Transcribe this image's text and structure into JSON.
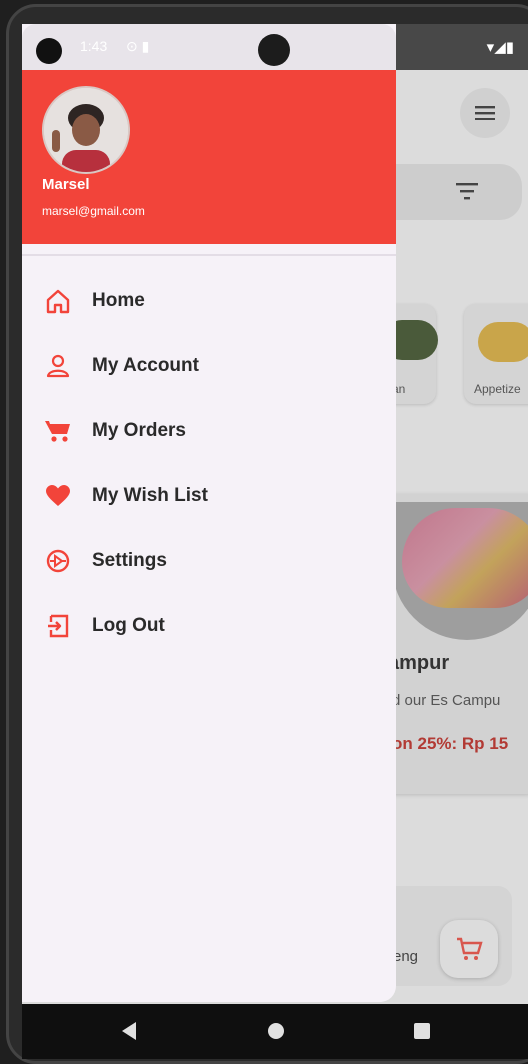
{
  "status_bar": {
    "time": "1:43",
    "notification_icons": "⊙ ▮",
    "system_icons": "▾◢▮"
  },
  "drawer": {
    "user": {
      "name": "Marsel",
      "email": "marsel@gmail.com"
    },
    "menu": [
      {
        "label": "Home",
        "icon": "home-icon"
      },
      {
        "label": "My Account",
        "icon": "person-icon"
      },
      {
        "label": "My Orders",
        "icon": "cart-icon"
      },
      {
        "label": "My Wish List",
        "icon": "heart-icon"
      },
      {
        "label": "Settings",
        "icon": "settings-icon"
      },
      {
        "label": "Log Out",
        "icon": "logout-icon"
      }
    ]
  },
  "background": {
    "categories": [
      {
        "label": "an"
      },
      {
        "label": "Appetize"
      }
    ],
    "promo": {
      "title": "ampur",
      "description": "d our Es Campu",
      "price": "on 25%: Rp 15"
    },
    "card_text": "reng"
  },
  "colors": {
    "accent": "#f2443a",
    "drawer_bg": "#f6f2f8",
    "text": "#2a2a2a"
  }
}
